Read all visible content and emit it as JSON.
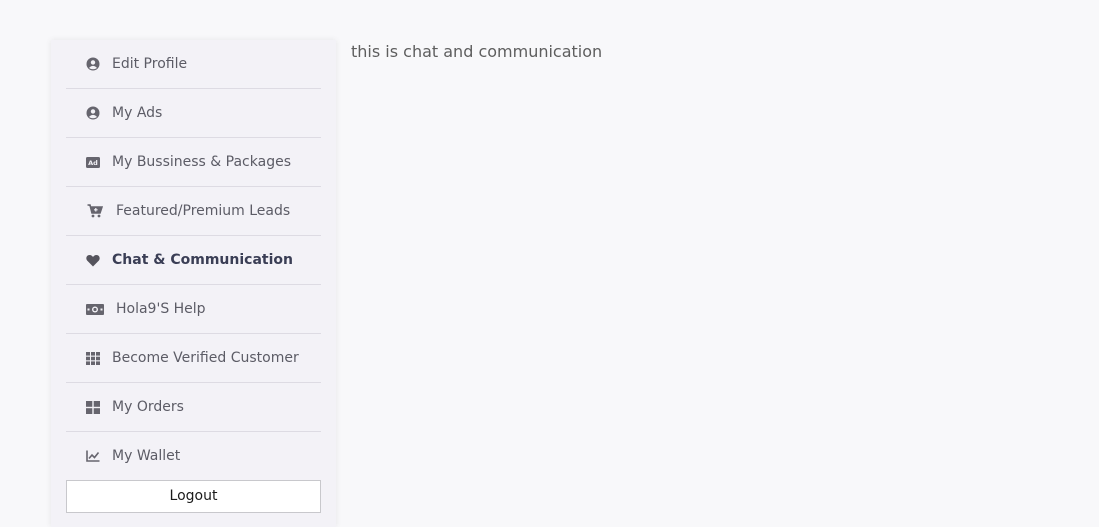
{
  "sidebar": {
    "items": [
      {
        "label": "Edit Profile",
        "icon": "user-circle-icon",
        "active": false
      },
      {
        "label": "My Ads",
        "icon": "user-circle-icon",
        "active": false
      },
      {
        "label": "My Bussiness & Packages",
        "icon": "ad-icon",
        "active": false
      },
      {
        "label": "Featured/Premium Leads",
        "icon": "cart-icon",
        "active": false
      },
      {
        "label": "Chat & Communication",
        "icon": "heart-icon",
        "active": true
      },
      {
        "label": "Hola9'S Help",
        "icon": "money-bill-icon",
        "active": false
      },
      {
        "label": "Become Verified Customer",
        "icon": "grid-icon",
        "active": false
      },
      {
        "label": "My Orders",
        "icon": "dashboard-icon",
        "active": false
      },
      {
        "label": "My Wallet",
        "icon": "chart-line-icon",
        "active": false
      }
    ],
    "logout_label": "Logout"
  },
  "main": {
    "text": "this is chat and communication"
  }
}
